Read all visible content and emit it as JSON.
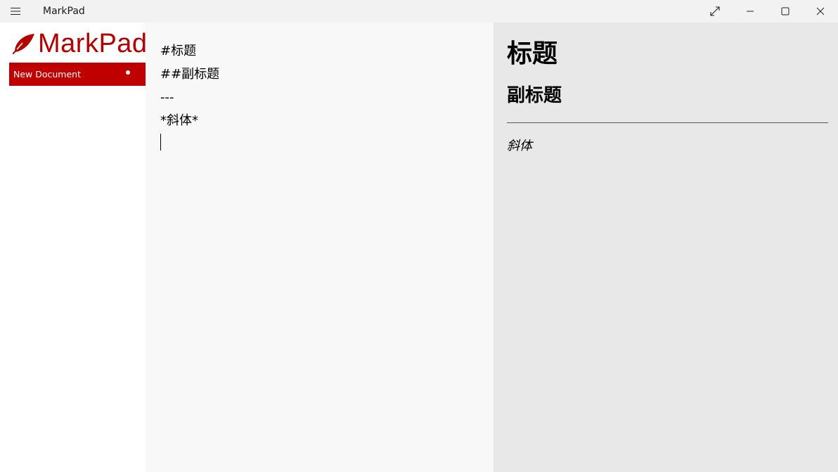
{
  "window": {
    "title": "MarkPad",
    "controls": [
      "fullscreen",
      "minimize",
      "maximize",
      "close"
    ]
  },
  "sidebar": {
    "logo_text": "MarkPad",
    "brand_color": "#c00000",
    "documents": [
      {
        "label": "New Document",
        "unsaved": true
      }
    ]
  },
  "editor": {
    "lines": [
      "#标题",
      "##副标题",
      "---",
      "*斜体*"
    ]
  },
  "preview": {
    "h1": "标题",
    "h2": "副标题",
    "em": "斜体"
  }
}
